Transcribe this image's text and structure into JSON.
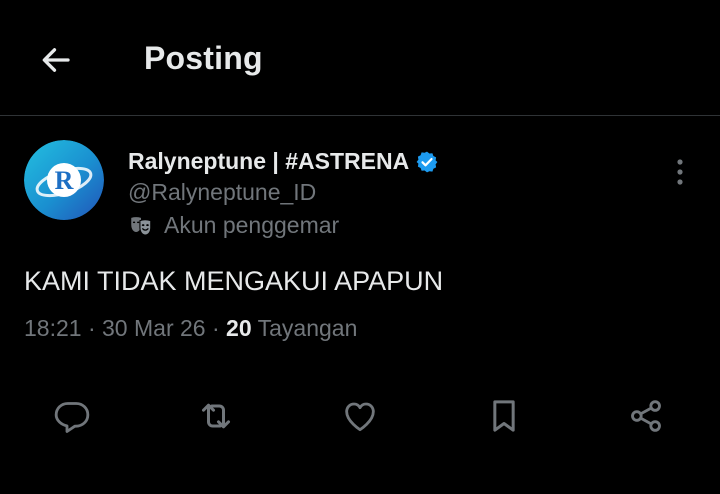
{
  "header": {
    "title": "Posting",
    "back_icon": "arrow-left-icon"
  },
  "author": {
    "name": "Ralyneptune | #ASTRENA",
    "handle": "@Ralyneptune_ID",
    "verified": true,
    "badge_label": "Akun penggemar",
    "badge_icon": "theater-mask-icon",
    "avatar_letter": "R"
  },
  "post": {
    "text": "KAMI TIDAK MENGAKUI APAPUN",
    "time": "18:21",
    "date": "30 Mar 26",
    "separator": "·",
    "views_count": "20",
    "views_label": "Tayangan"
  },
  "actions": [
    "reply-icon",
    "repost-icon",
    "like-icon",
    "bookmark-icon",
    "share-icon"
  ],
  "colors": {
    "background": "#000000",
    "text_primary": "#e7e9ea",
    "text_secondary": "#71767b",
    "verified_blue": "#1d9bf0",
    "divider": "#2f3336"
  }
}
